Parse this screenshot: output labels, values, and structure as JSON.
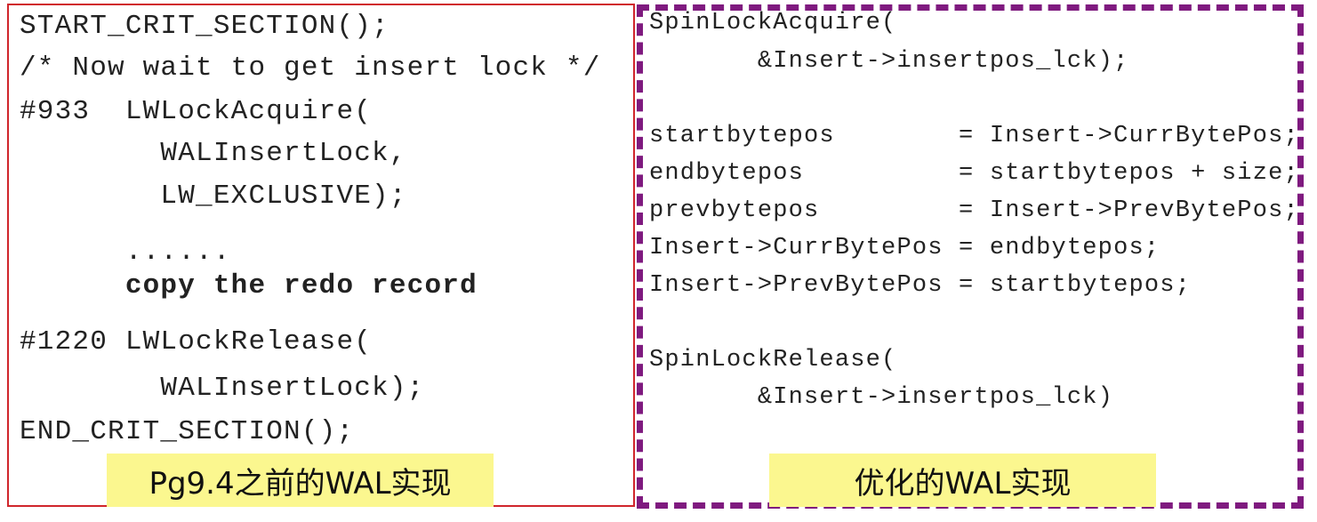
{
  "left": {
    "lines": [
      "START_CRIT_SECTION();",
      "/* Now wait to get insert lock */",
      "#933  LWLockAcquire(",
      "        WALInsertLock,",
      "        LW_EXCLUSIVE);",
      "      ......",
      "      copy the redo record",
      "#1220 LWLockRelease(",
      "        WALInsertLock);",
      "END_CRIT_SECTION();"
    ],
    "label": "Pg9.4之前的WAL实现",
    "border_color": "#d0262c"
  },
  "right": {
    "lines": [
      "SpinLockAcquire(",
      "       &Insert->insertpos_lck);",
      "startbytepos        = Insert->CurrBytePos;",
      "endbytepos          = startbytepos + size;",
      "prevbytepos         = Insert->PrevBytePos;",
      "Insert->CurrBytePos = endbytepos;",
      "Insert->PrevBytePos = startbytepos;",
      "SpinLockRelease(",
      "       &Insert->insertpos_lck)"
    ],
    "label": "优化的WAL实现",
    "border_color": "#7f1a7f"
  },
  "label_bg": "#fbf78f"
}
